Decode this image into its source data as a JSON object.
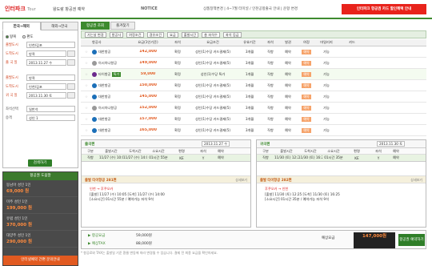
{
  "header": {
    "logo": "인터파크",
    "logo_sub": "Tour",
    "subtitle": "왕도랑 항공권 예약",
    "notice_label": "NOTICE",
    "notice_text": "상품정책변경 | 4~7월 터미널 / 인천공항출국 안내 | 운항 변경",
    "banner": "인터파크 항공권 카드 할인혜택 안내"
  },
  "left": {
    "tabs": [
      "한국→해외",
      "해외→한국"
    ],
    "trip": [
      "왕복",
      "편도"
    ],
    "rows": [
      {
        "label": "출발도시",
        "value": "인천/김포"
      },
      {
        "label": "도착도시",
        "value": "방콕"
      },
      {
        "label": "출 국 일",
        "value": "2013.11.27 수"
      },
      {
        "label": "출발도시",
        "value": "방콕"
      },
      {
        "label": "도착도시",
        "value": "인천/김포"
      },
      {
        "label": "귀 국 일",
        "value": "2013.11.30 토"
      }
    ],
    "class_label": "좌석선택",
    "class_value": "일반석",
    "pax_label": "승객",
    "pax": "성인 1",
    "search_button": "검색하기",
    "fare_title": "항공권 도움말",
    "fares": [
      {
        "name": "동남아 성인 1인",
        "value": "69,000 원"
      },
      {
        "name": "미주 성인 1인",
        "value": "199,000 원"
      },
      {
        "name": "유럽 성인 1인",
        "value": "370,000 원"
      },
      {
        "name": "대양주 성인 1인",
        "value": "290,000 원"
      }
    ],
    "fare_bottom": "인터넷예약 간편 문의안내"
  },
  "results": {
    "tabs": [
      "항공권 조회",
      "즐겨찾기"
    ],
    "filters": [
      "가는날 변경",
      "항공사",
      "여정조건",
      "경유조건",
      "요금",
      "출발시간",
      "총 좌석수",
      "좌석 등급"
    ],
    "columns": [
      "",
      "항공사",
      "요금(1인기준)",
      "좌석",
      "요금조건",
      "유효기간",
      "좌석",
      "발권",
      "여정",
      "마일리지",
      "카드"
    ],
    "rows": [
      {
        "airline": "대한항공",
        "price": "142,000",
        "seat": "확정",
        "cond": "성인(1)수당 카드결제(5)",
        "valid": "3개월",
        "s": "직항",
        "tk": "예약",
        "mile": "가능",
        "color": "#1b6fb8"
      },
      {
        "airline": "아시아나항공",
        "price": "149,000",
        "seat": "확정",
        "cond": "성인(1)수당 카드결제(5)",
        "valid": "3개월",
        "s": "직항",
        "tk": "예약",
        "mile": "가능",
        "color": "#999"
      },
      {
        "airline": "타이항공",
        "price": "59,000",
        "seat": "확정",
        "cond": "성인(1)수당 특가",
        "valid": "1개월",
        "s": "직항",
        "tk": "예약",
        "mile": "가능",
        "color": "#6b2a8c",
        "badge": "특가"
      },
      {
        "airline": "대한항공",
        "price": "150,000",
        "seat": "확정",
        "cond": "성인(1)수당 카드결제(5)",
        "valid": "3개월",
        "s": "직항",
        "tk": "예약",
        "mile": "가능",
        "color": "#1b6fb8"
      },
      {
        "airline": "대한항공",
        "price": "145,000",
        "seat": "확정",
        "cond": "성인(1)수당 카드결제(5)",
        "valid": "3개월",
        "s": "직항",
        "tk": "예약",
        "mile": "가능",
        "color": "#1b6fb8"
      },
      {
        "airline": "아시아나항공",
        "price": "152,000",
        "seat": "확정",
        "cond": "성인(1)수당 카드결제(5)",
        "valid": "3개월",
        "s": "직항",
        "tk": "예약",
        "mile": "가능",
        "color": "#999"
      },
      {
        "airline": "대한항공",
        "price": "157,000",
        "seat": "확정",
        "cond": "성인(1)수당 카드결제(5)",
        "valid": "3개월",
        "s": "직항",
        "tk": "예약",
        "mile": "가능",
        "color": "#1b6fb8"
      },
      {
        "airline": "대한항공",
        "price": "165,000",
        "seat": "확정",
        "cond": "성인(1)수당 카드결제(5)",
        "valid": "3개월",
        "s": "직항",
        "tk": "예약",
        "mile": "가능",
        "color": "#1b6fb8"
      }
    ]
  },
  "outbound": {
    "title": "출국편",
    "date": "2013.11.27 수",
    "cols": [
      "구분",
      "출발시간",
      "도착시간",
      "소요시간",
      "편명",
      "좌석",
      "예약"
    ],
    "row": [
      "직항",
      "11/27 (수) 10:05",
      "11/27 (수) 14:00",
      "01시간 55분",
      "KE",
      "Y",
      "예약"
    ],
    "sub_a": "출발  타이항공 281편",
    "sub_b": "상세보기",
    "d1": "인천 → 후쿠오카",
    "d2": "[출발] 11/27 (수) 10:05  [도착] 11/27 (수) 14:00",
    "d3": "[소요시간] 01시간 55분 / 예약가능 좌석 9석"
  },
  "inbound": {
    "title": "귀국편",
    "date": "2013.11.30 토",
    "cols": [
      "구분",
      "출발시간",
      "도착시간",
      "소요시간",
      "편명",
      "좌석",
      "예약"
    ],
    "row": [
      "직항",
      "11/30 (토) 12:25",
      "11/30 (토) 16:25",
      "01시간 35분",
      "KE",
      "Y",
      "예약"
    ],
    "sub_a": "출발  타이항공 282편",
    "sub_b": "상세보기",
    "d1": "후쿠오카 → 인천",
    "d2": "[출발] 11/30 (토) 12:25  [도착] 11/30 (토) 16:25",
    "d3": "[소요시간] 01시간 35분 / 예약가능 좌석 9석"
  },
  "summary": {
    "l1": "▶ 항공요금",
    "v1": "59,000원",
    "l2": "▶ 예상TAX",
    "v2": "88,000원",
    "total_label": "예상요금",
    "total": "147,000원",
    "go": "항공권 예약하기",
    "note": "* 항공료와 TAX는 출발일 기준 환율 변동에 따라 변경될 수 있습니다. 결제 전 최종 요금을 확인하세요."
  }
}
